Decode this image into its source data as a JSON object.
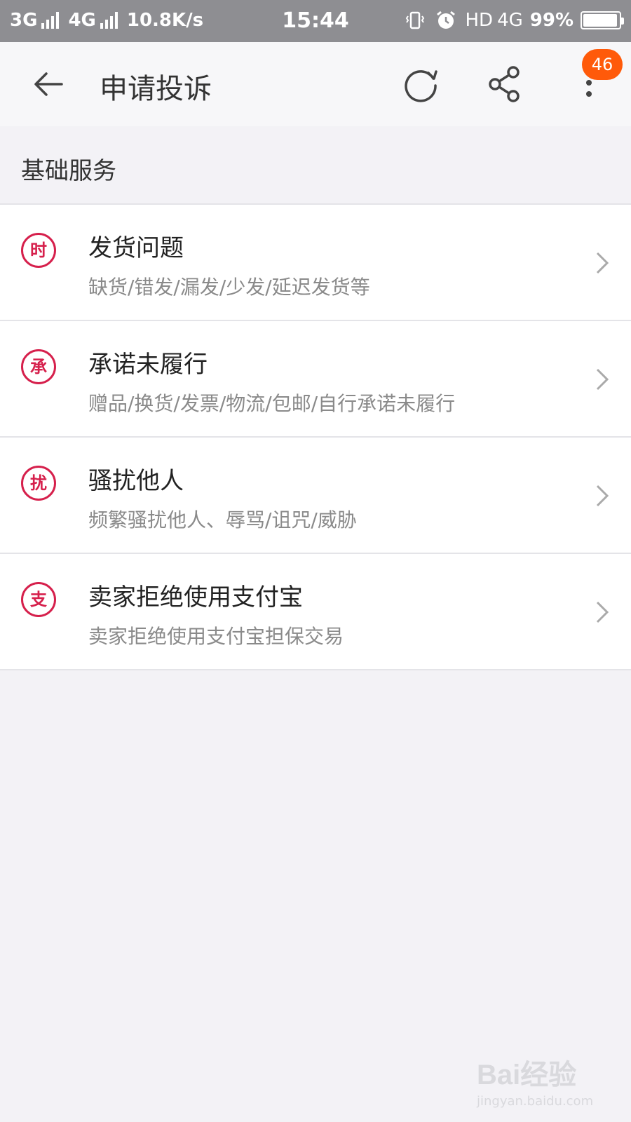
{
  "status_bar": {
    "net1": "3G",
    "net2": "4G",
    "speed": "10.8K/s",
    "time": "15:44",
    "hd": "HD",
    "net3": "4G",
    "battery": "99%"
  },
  "top_bar": {
    "title": "申请投诉",
    "badge_count": "46"
  },
  "section": {
    "title": "基础服务"
  },
  "items": [
    {
      "icon_char": "时",
      "title": "发货问题",
      "subtitle": "缺货/错发/漏发/少发/延迟发货等"
    },
    {
      "icon_char": "承",
      "title": "承诺未履行",
      "subtitle": "赠品/换货/发票/物流/包邮/自行承诺未履行"
    },
    {
      "icon_char": "扰",
      "title": "骚扰他人",
      "subtitle": "频繁骚扰他人、辱骂/诅咒/威胁"
    },
    {
      "icon_char": "支",
      "title": "卖家拒绝使用支付宝",
      "subtitle": "卖家拒绝使用支付宝担保交易"
    }
  ],
  "watermark": {
    "logo": "Bai经验",
    "url": "jingyan.baidu.com"
  },
  "colors": {
    "accent": "#d6204c",
    "badge": "#ff5a0a",
    "status_bar": "#8e8e92"
  }
}
